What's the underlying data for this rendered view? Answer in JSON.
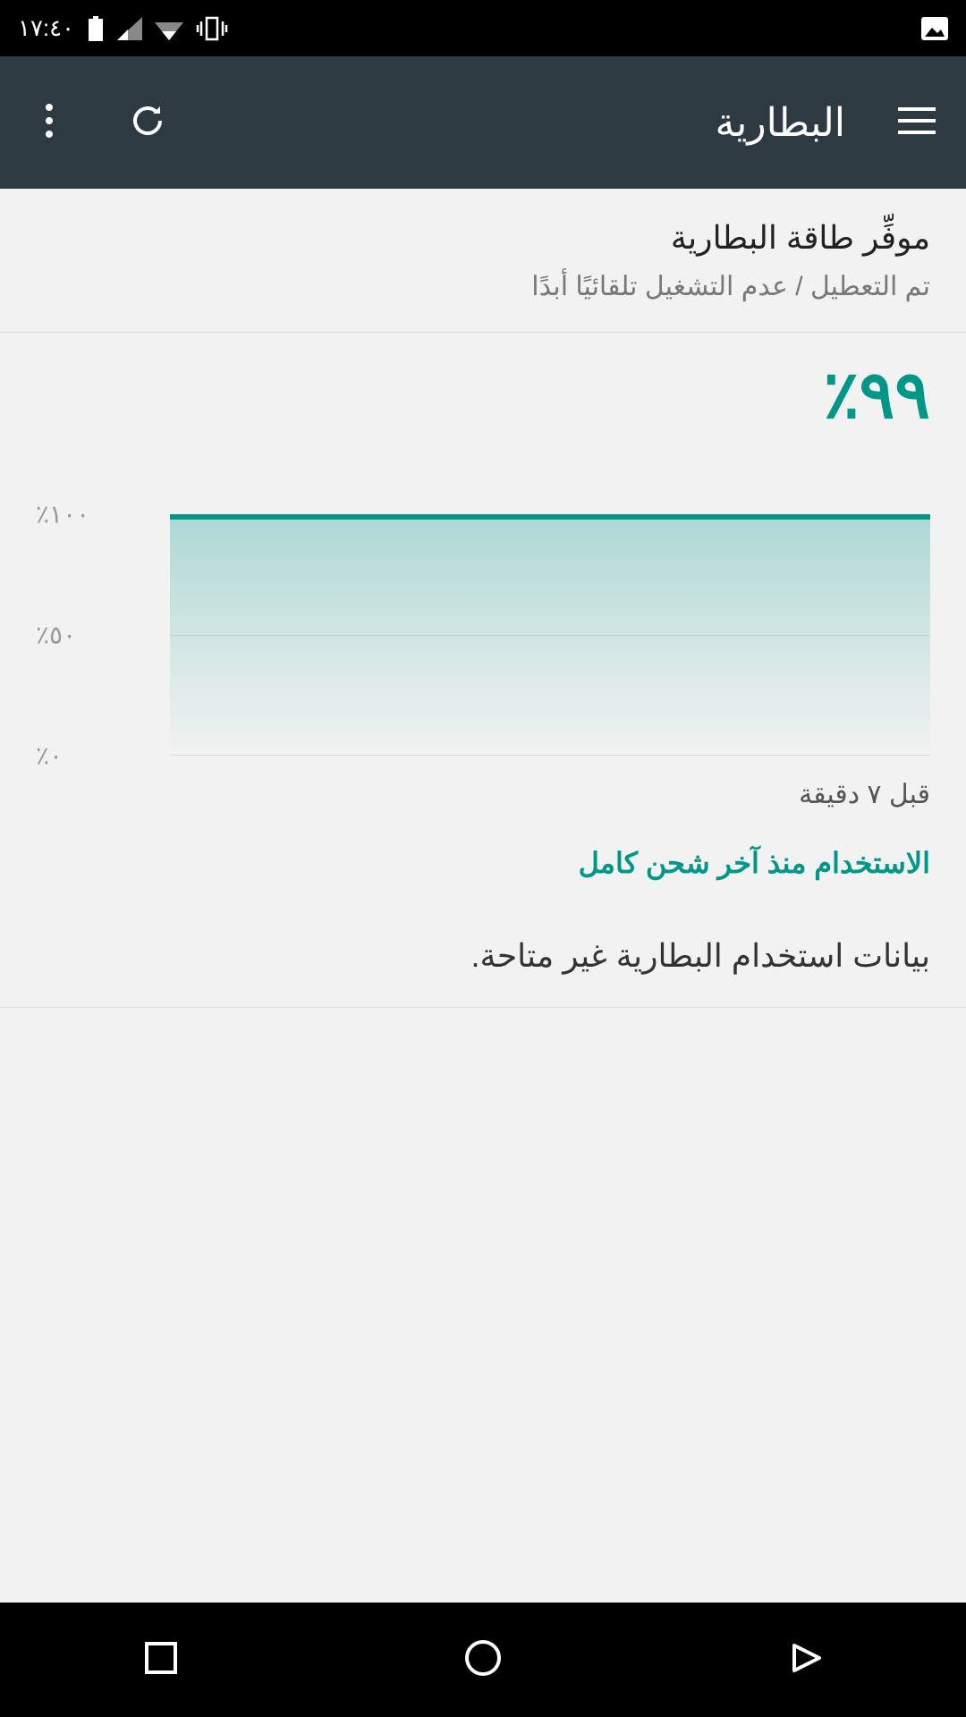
{
  "statusbar": {
    "time": "١٧:٤٠"
  },
  "appbar": {
    "title": "البطارية"
  },
  "saver": {
    "title": "موفِّر طاقة البطارية",
    "subtitle": "تم التعطيل / عدم التشغيل تلقائيًا أبدًا"
  },
  "battery": {
    "percent_text": "٩٩٪",
    "subtitle": "",
    "time_since": "قبل ٧ دقيقة"
  },
  "chart": {
    "y100": "٪١٠٠",
    "y50": "٪٥٠",
    "y0": "٪٠"
  },
  "usage": {
    "heading": "الاستخدام منذ آخر شحن كامل",
    "no_data": "بيانات استخدام البطارية غير متاحة."
  },
  "chart_data": {
    "type": "area",
    "title": "",
    "xlabel": "",
    "ylabel": "",
    "ylim": [
      0,
      100
    ],
    "x": [
      0,
      7
    ],
    "values": [
      99,
      99
    ],
    "x_end_label": "قبل ٧ دقيقة",
    "y_ticks": [
      0,
      50,
      100
    ],
    "y_tick_labels": [
      "٪٠",
      "٪٥٠",
      "٪١٠٠"
    ]
  }
}
